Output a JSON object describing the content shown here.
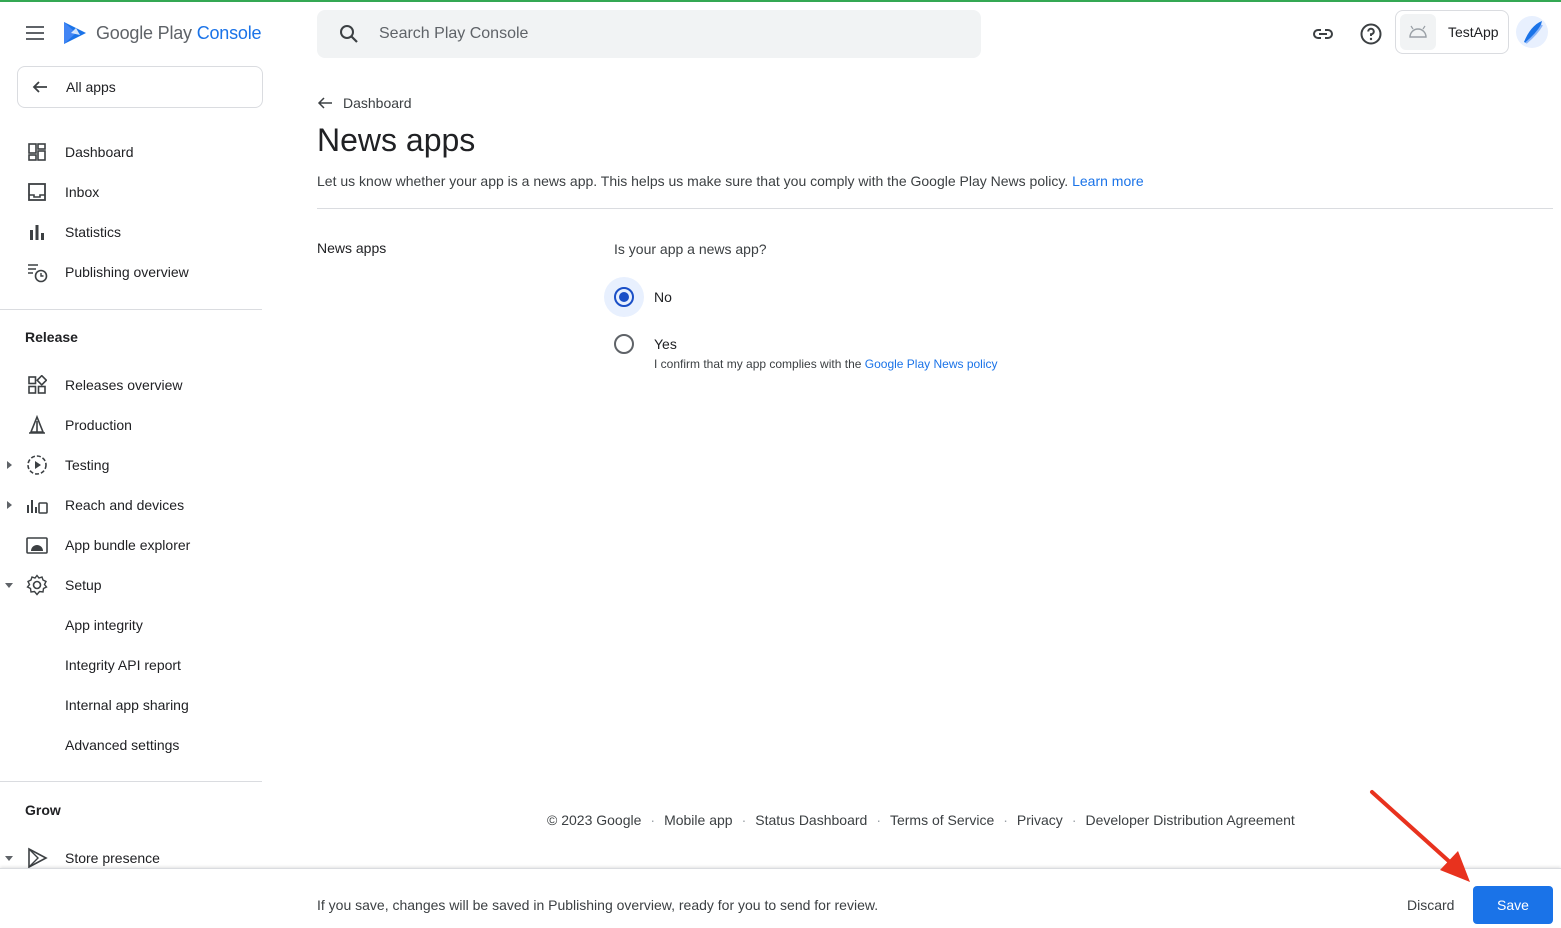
{
  "app": {
    "logo_primary": "Google Play",
    "logo_accent": "Console"
  },
  "sidebar": {
    "all_apps_label": "All apps",
    "items": [
      {
        "label": "Dashboard",
        "icon": "dashboard-icon"
      },
      {
        "label": "Inbox",
        "icon": "inbox-icon"
      },
      {
        "label": "Statistics",
        "icon": "bar-chart-icon"
      },
      {
        "label": "Publishing overview",
        "icon": "publishing-icon"
      }
    ],
    "release_section": {
      "title": "Release",
      "items": [
        {
          "label": "Releases overview",
          "icon": "releases-grid-icon"
        },
        {
          "label": "Production",
          "icon": "production-icon"
        },
        {
          "label": "Testing",
          "icon": "testing-icon",
          "expandable": true,
          "expanded": false
        },
        {
          "label": "Reach and devices",
          "icon": "reach-devices-icon",
          "expandable": true,
          "expanded": false
        },
        {
          "label": "App bundle explorer",
          "icon": "android-bundle-icon"
        },
        {
          "label": "Setup",
          "icon": "gear-icon",
          "expandable": true,
          "expanded": true
        },
        {
          "label": "App integrity"
        },
        {
          "label": "Integrity API report"
        },
        {
          "label": "Internal app sharing"
        },
        {
          "label": "Advanced settings"
        }
      ]
    },
    "grow_section": {
      "title": "Grow",
      "items": [
        {
          "label": "Store presence",
          "icon": "store-presence-icon",
          "expandable": true,
          "expanded": true
        }
      ]
    }
  },
  "header": {
    "search_placeholder": "Search Play Console",
    "app_name": "TestApp"
  },
  "main": {
    "breadcrumb": "Dashboard",
    "title": "News apps",
    "description": "Let us know whether your app is a news app. This helps us make sure that you comply with the Google Play News policy.",
    "learn_more": "Learn more",
    "field_label": "News apps",
    "question": "Is your app a news app?",
    "options": [
      {
        "label": "No",
        "selected": true
      },
      {
        "label": "Yes",
        "selected": false,
        "sublabel_prefix": "I confirm that my app complies with the",
        "sublabel_link": "Google Play News policy"
      }
    ]
  },
  "footer": {
    "copyright": "© 2023 Google",
    "links": [
      "Mobile app",
      "Status Dashboard",
      "Terms of Service",
      "Privacy",
      "Developer Distribution Agreement"
    ]
  },
  "bottom_bar": {
    "message": "If you save, changes will be saved in Publishing overview, ready for you to send for review.",
    "discard_label": "Discard",
    "save_label": "Save"
  },
  "colors": {
    "accent": "#1a73e8",
    "radio_selected": "#1a4fc7",
    "annotation_arrow": "#e8321e"
  }
}
